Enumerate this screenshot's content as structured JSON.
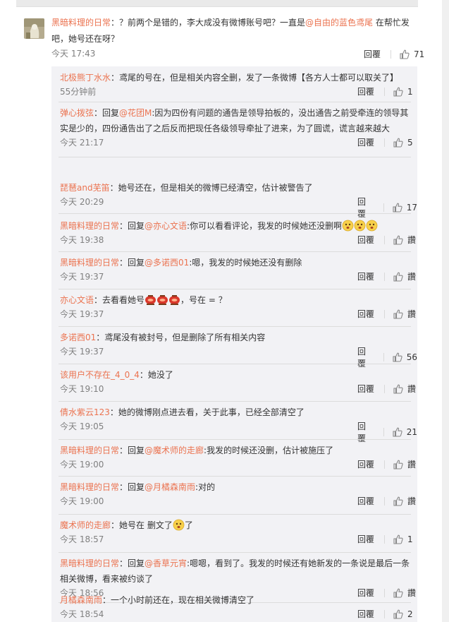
{
  "main_comment": {
    "user": "黑暗料理的日常",
    "text_before": "：？前两个是错的，李大成没有微博账号吧？一直是",
    "mention": "@自由的蓝色鸢尾",
    "text_after": " 在帮忙发吧，她号还在呀？",
    "time": "今天 17:43",
    "reply_label": "回覆",
    "likes": "71"
  },
  "replies": [
    {
      "user": "北极熊丁水水",
      "prefix": "",
      "mention": "",
      "text": "：鸢尾的号在，但是相关内容全删，发了一条微博【各方人士都可以取关了】",
      "time": "55分钟前",
      "reply_label": "回覆",
      "likes": "1"
    },
    {
      "user": "弹心拨弦",
      "prefix": "：回复",
      "mention": "@花团M",
      "text": ":因为四份有问题的通告是领导拍板的，没出通告之前受牵连的领导其实是少的，四份通告出了之后反而把现任各级领导牵扯了进来，为了圆谎，谎言越来越大",
      "time": "今天 21:17",
      "reply_label": "回覆",
      "likes": "5"
    },
    {
      "user": "琵琶and芜笛",
      "prefix": "",
      "mention": "",
      "text": "：她号还在，但是相关的微博已经清空，估计被警告了",
      "time": "今天 20:29",
      "reply_label": "回覆",
      "likes": "17"
    },
    {
      "user": "黑暗料理的日常",
      "prefix": "：回复",
      "mention": "@亦心文语",
      "text": ":你可以看看评论，我发的时候她还没删啊",
      "time": "今天 19:38",
      "reply_label": "回覆",
      "likes": "讚",
      "emoji": "3face"
    },
    {
      "user": "黑暗料理的日常",
      "prefix": "：回复",
      "mention": "@多诺西01",
      "text": ":嗯，我发的时候她还没有删除",
      "time": "今天 19:37",
      "reply_label": "回覆",
      "likes": "讚"
    },
    {
      "user": "亦心文语",
      "prefix": "",
      "mention": "",
      "text": "：去看看她号",
      "text2": "，号在 = ？",
      "time": "今天 19:37",
      "reply_label": "回覆",
      "likes": "讚",
      "emoji": "3red"
    },
    {
      "user": "多诺西01",
      "prefix": "",
      "mention": "",
      "text": "：鸢尾没有被封号，但是删除了所有相关内容",
      "time": "今天 19:37",
      "reply_label": "回覆",
      "likes": "56"
    },
    {
      "user": "该用户不存在_4_0_4",
      "prefix": "",
      "mention": "",
      "text": "：她没了",
      "time": "今天 19:10",
      "reply_label": "回覆",
      "likes": "讚"
    },
    {
      "user": "倩水紫云123",
      "prefix": "",
      "mention": "",
      "text": "：她的微博刚点进去看，关于此事，已经全部清空了",
      "time": "今天 19:05",
      "reply_label": "回覆",
      "likes": "21"
    },
    {
      "user": "黑暗料理的日常",
      "prefix": "：回复",
      "mention": "@魔术师的走廊",
      "text": ":我发的时候还没删，估计被施压了",
      "time": "今天 19:00",
      "reply_label": "回覆",
      "likes": "讚"
    },
    {
      "user": "黑暗料理的日常",
      "prefix": "：回复",
      "mention": "@月橘森南雨",
      "text": ":对的",
      "time": "今天 19:00",
      "reply_label": "回覆",
      "likes": "讚"
    },
    {
      "user": "魔术师的走廊",
      "prefix": "",
      "mention": "",
      "text": "：她号在 删文了",
      "text2": "了",
      "time": "今天 18:57",
      "reply_label": "回覆",
      "likes": "1",
      "emoji": "1face"
    },
    {
      "user": "黑暗料理的日常",
      "prefix": "：回复",
      "mention": "@香草元宵",
      "text": ":嗯嗯，看到了。我发的时候还有她新发的一条说是最后一条相关微博，看来被约谈了",
      "time": "今天 18:56",
      "reply_label": "回覆",
      "likes": "讚"
    },
    {
      "user": "月橘森南雨",
      "prefix": "",
      "mention": "",
      "text": "：一个小时前还在，现在相关微博清空了",
      "time": "今天 18:54",
      "reply_label": "回覆",
      "likes": "2"
    }
  ],
  "colors": {
    "link": "#eb7350",
    "time": "#808080",
    "reply_bg": "#f2f2f5"
  },
  "icons": {
    "like": "thumbs-up-icon"
  }
}
